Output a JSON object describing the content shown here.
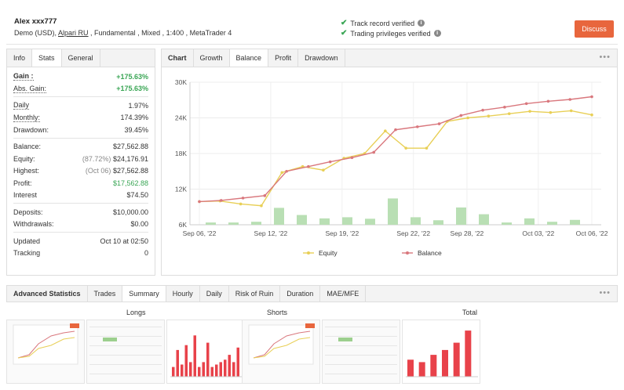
{
  "header": {
    "account_name": "Alex xxx777",
    "meta_prefix": "Demo (USD), ",
    "broker": "Alpari RU",
    "meta_suffix": " , Fundamental , Mixed , 1:400 , MetaTrader 4",
    "verify_track": "Track record verified",
    "verify_privileges": "Trading privileges verified",
    "discuss_label": "Discuss",
    "colors": {
      "accent": "#e8663d",
      "verified": "#3aa655"
    }
  },
  "left_tabs": [
    "Info",
    "Stats",
    "General"
  ],
  "stats": {
    "gain_label": "Gain :",
    "gain_value": "+175.63%",
    "abs_gain_label": "Abs. Gain:",
    "abs_gain_value": "+175.63%",
    "daily_label": "Daily",
    "daily_value": "1.97%",
    "monthly_label": "Monthly:",
    "monthly_value": "174.39%",
    "drawdown_label": "Drawdown:",
    "drawdown_value": "39.45%",
    "balance_label": "Balance:",
    "balance_value": "$27,562.88",
    "equity_label": "Equity:",
    "equity_note": "(87.72%)",
    "equity_value": "$24,176.91",
    "highest_label": "Highest:",
    "highest_note": "(Oct 06)",
    "highest_value": "$27,562.88",
    "profit_label": "Profit:",
    "profit_value": "$17,562.88",
    "interest_label": "Interest",
    "interest_value": "$74.50",
    "deposits_label": "Deposits:",
    "deposits_value": "$10,000.00",
    "withdrawals_label": "Withdrawals:",
    "withdrawals_value": "$0.00",
    "updated_label": "Updated",
    "updated_value": "Oct 10 at 02:50",
    "tracking_label": "Tracking",
    "tracking_value": "0"
  },
  "chart_tabs": [
    "Chart",
    "Growth",
    "Balance",
    "Profit",
    "Drawdown"
  ],
  "more_label": "•••",
  "chart_data": {
    "type": "line",
    "y_ticks": [
      "30K",
      "24K",
      "18K",
      "12K",
      "6K"
    ],
    "ylim": [
      6000,
      30000
    ],
    "x_tick_labels": [
      "Sep 06, '22",
      "Sep 12, '22",
      "Sep 19, '22",
      "Sep 22, '22",
      "Sep 28, '22",
      "Oct 03, '22",
      "Oct 06, '22"
    ],
    "x_tick_index": [
      0,
      4,
      8,
      12,
      15,
      19,
      22
    ],
    "series": [
      {
        "name": "Equity",
        "color": "#e8cf56",
        "values": [
          9900,
          10000,
          9500,
          9200,
          14800,
          15800,
          15200,
          17200,
          18000,
          21800,
          18900,
          18900,
          23400,
          24000,
          24300,
          24700,
          25100,
          24900,
          25200,
          24500
        ]
      },
      {
        "name": "Balance",
        "color": "#d9777d",
        "values": [
          9900,
          10100,
          10500,
          10900,
          15000,
          15800,
          16600,
          17300,
          18200,
          22000,
          22500,
          23000,
          24400,
          25300,
          25800,
          26400,
          26800,
          27100,
          27560
        ]
      }
    ],
    "volume_bars": [
      0.06,
      0.06,
      0.08,
      0.45,
      0.26,
      0.17,
      0.2,
      0.16,
      0.7,
      0.2,
      0.12,
      0.46,
      0.28,
      0.06,
      0.17,
      0.08,
      0.13
    ],
    "volume_color": "#b9dfb4",
    "grid": true,
    "legend": "bottom"
  },
  "adv_tabs": [
    "Advanced Statistics",
    "Trades",
    "Summary",
    "Hourly",
    "Daily",
    "Risk of Ruin",
    "Duration",
    "MAE/MFE"
  ],
  "columns": {
    "longs": "Longs",
    "shorts": "Shorts",
    "total": "Total"
  },
  "mini_bars": {
    "longs": [
      0.2,
      0.55,
      0.25,
      0.65,
      0.3,
      0.85,
      0.2,
      0.3,
      0.7,
      0.2,
      0.25,
      0.3,
      0.35,
      0.45,
      0.3,
      0.6
    ],
    "total": [
      0.35,
      0.3,
      0.45,
      0.55,
      0.7,
      0.95
    ]
  }
}
